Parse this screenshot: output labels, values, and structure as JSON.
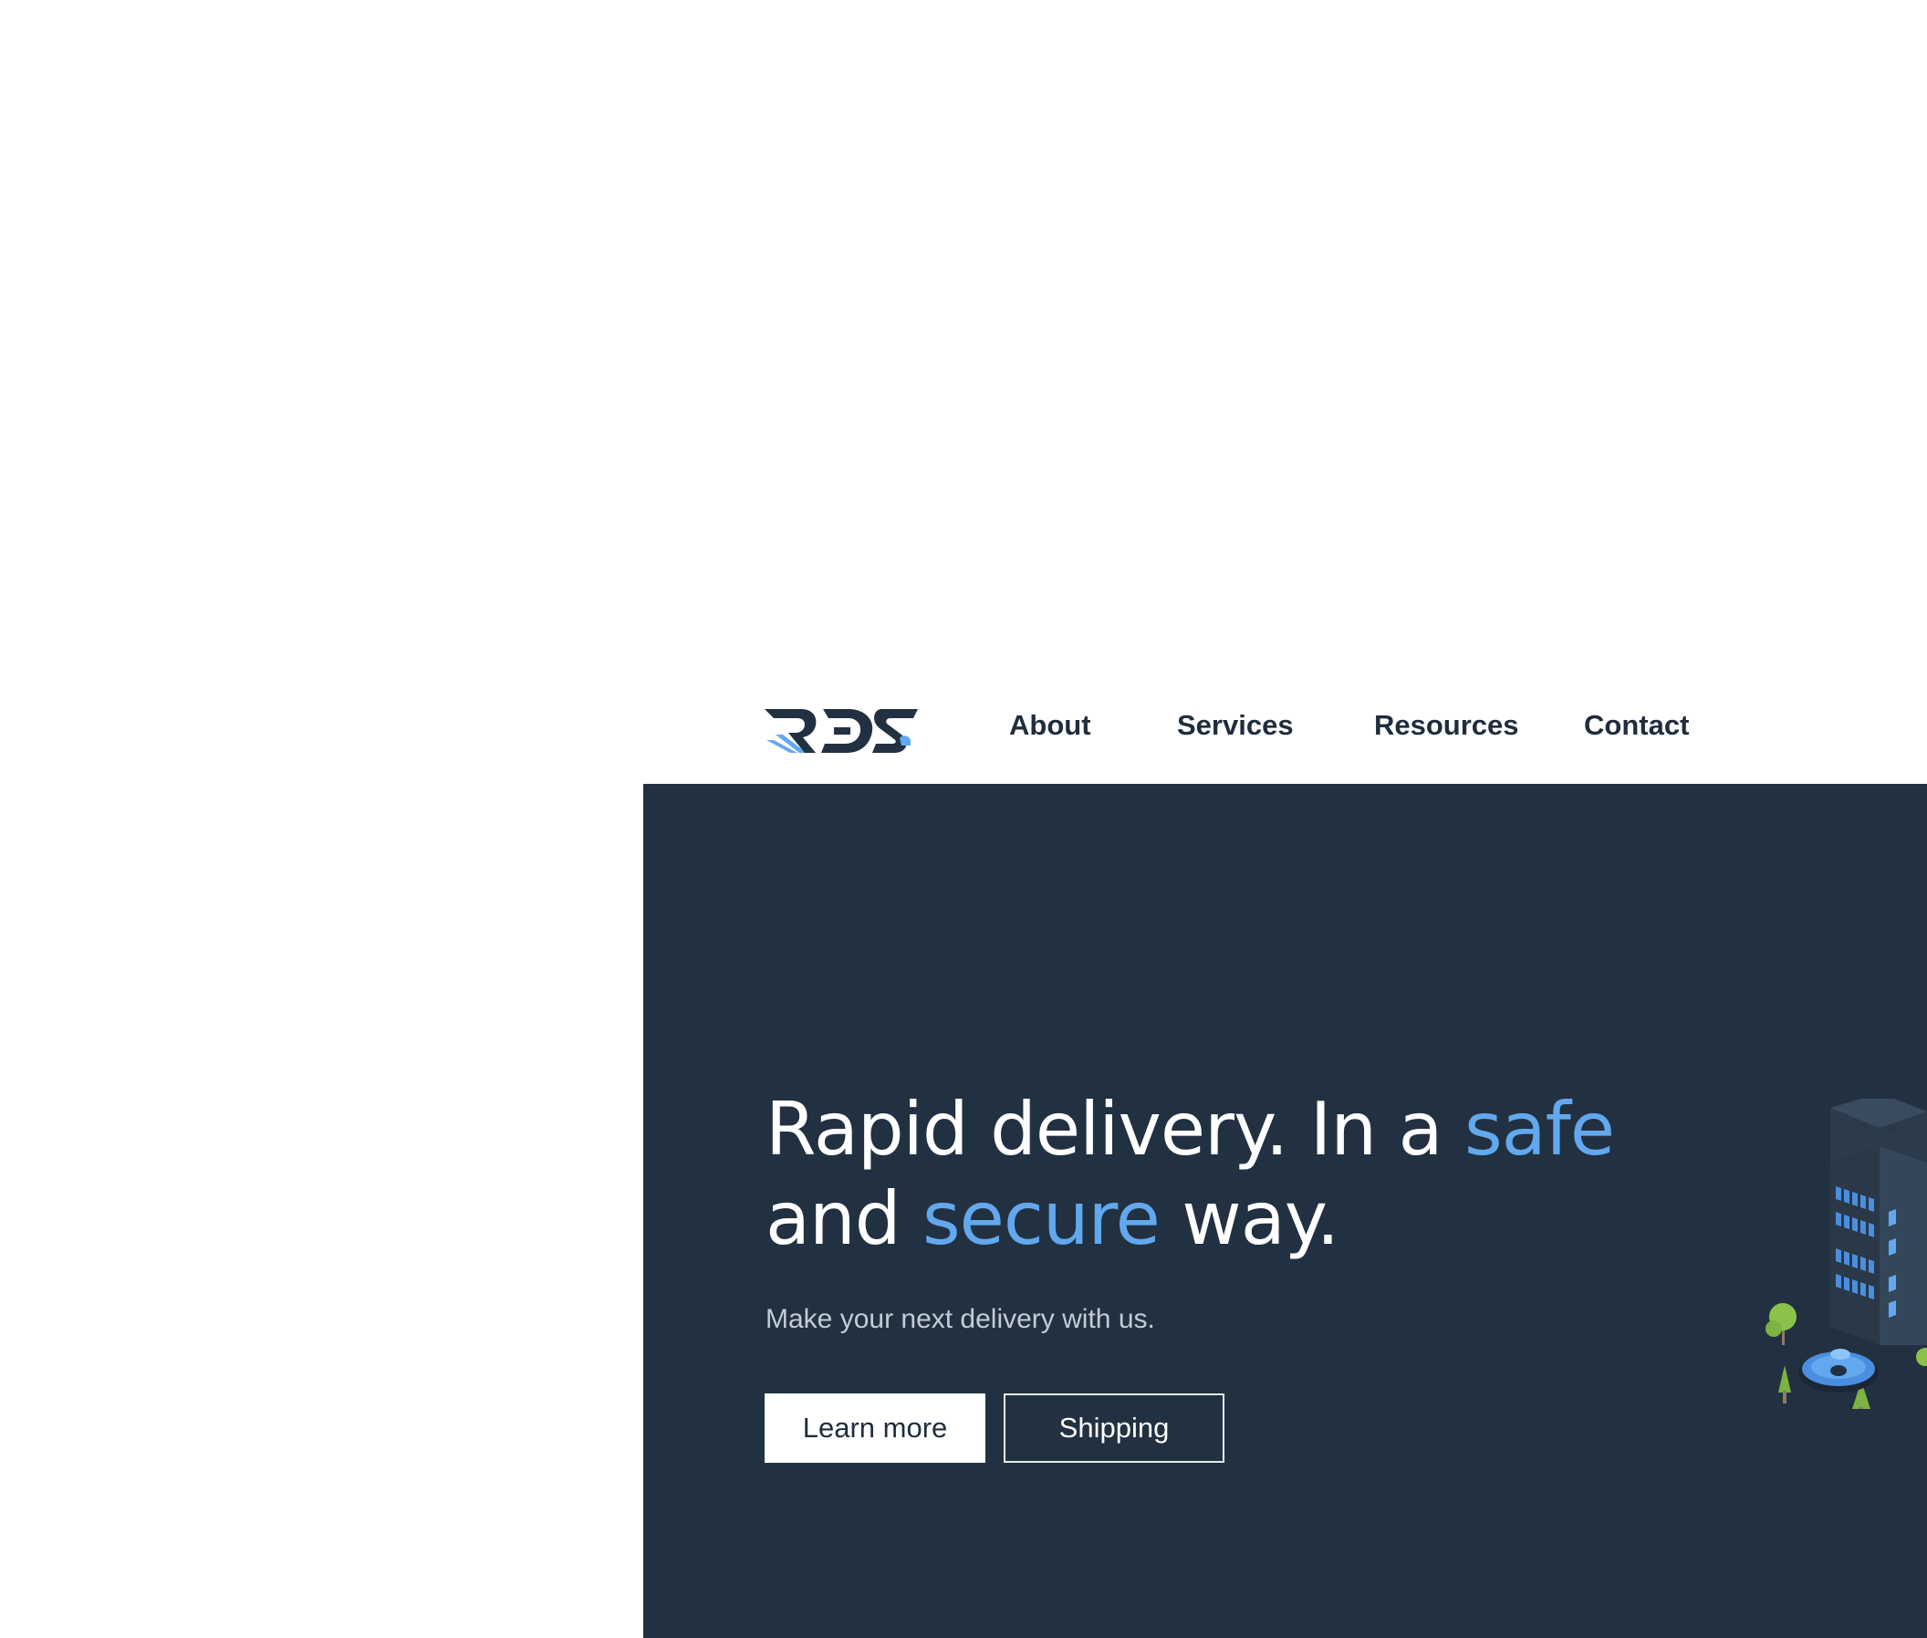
{
  "header": {
    "logo_alt": "RDS",
    "nav": [
      {
        "label": "About"
      },
      {
        "label": "Services"
      },
      {
        "label": "Resources"
      },
      {
        "label": "Contact"
      }
    ]
  },
  "hero": {
    "headline": {
      "part1": "Rapid delivery. In a ",
      "accent1": "safe",
      "part2": "and ",
      "accent2": "secure",
      "part3": " way."
    },
    "subtitle": "Make your next delivery with us.",
    "primary_button": "Learn more",
    "secondary_button": "Shipping"
  },
  "colors": {
    "hero_background": "#223141",
    "accent": "#62a8ee",
    "text_dark": "#1f2d3d",
    "tree_green": "#8bc34a"
  },
  "icons": {
    "logo": "rds-logo",
    "illustration": "isometric-city-illustration"
  }
}
